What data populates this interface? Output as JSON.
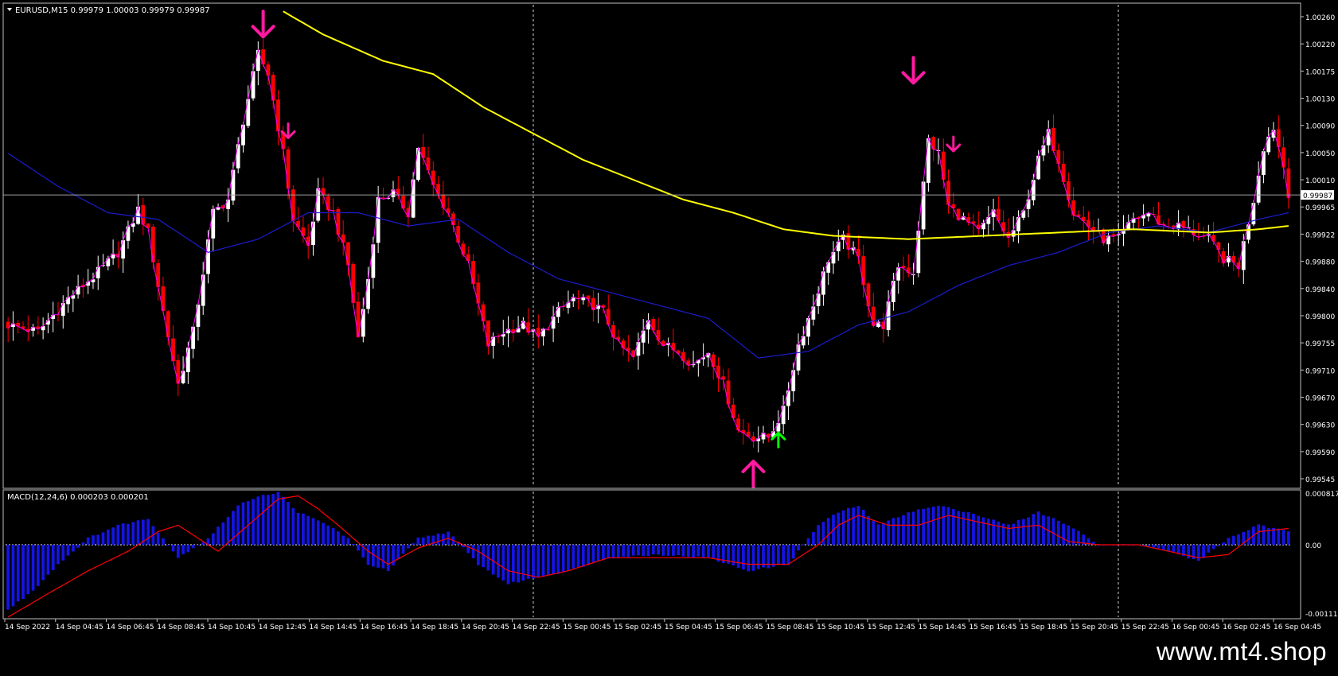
{
  "header": {
    "symbol_line": "EURUSD,M15  0.99979 1.00003 0.99979 0.99987",
    "macd_line": "MACD(12,24,6) 0.000203 0.000201"
  },
  "watermark": "www.mt4.shop",
  "colors": {
    "background": "#000000",
    "frame": "#c0c0c0",
    "bull_candle": "#ffffff",
    "bear_candle": "#ff0000",
    "sma_slow": "#ffff00",
    "sma_fast": "#1c1cd0",
    "close_line": "#ff00ff",
    "macd_hist": "#1414e6",
    "macd_signal": "#ff0000",
    "sell_arrow": "#ff1aa0",
    "buy_arrow": "#ff1aa0",
    "buy_arrow_small": "#00ff00",
    "current_price_line": "#a0a0a0"
  },
  "chart_data": [
    {
      "type": "candlestick",
      "symbol": "EURUSD",
      "timeframe": "M15",
      "current_price": "0.99987",
      "ylim": [
        0.99545,
        1.00275
      ],
      "y_ticks": [
        "1.00260",
        "1.00220",
        "1.00175",
        "1.00130",
        "1.00090",
        "1.00050",
        "1.00010",
        "0.99965",
        "0.99922",
        "0.99880",
        "0.99840",
        "0.99800",
        "0.99755",
        "0.99710",
        "0.99670",
        "0.99630",
        "0.99590",
        "0.99545"
      ],
      "x_ticks": [
        "14 Sep 2022",
        "14 Sep 04:45",
        "14 Sep 06:45",
        "14 Sep 08:45",
        "14 Sep 10:45",
        "14 Sep 12:45",
        "14 Sep 14:45",
        "14 Sep 16:45",
        "14 Sep 18:45",
        "14 Sep 20:45",
        "14 Sep 22:45",
        "15 Sep 00:45",
        "15 Sep 02:45",
        "15 Sep 04:45",
        "15 Sep 06:45",
        "15 Sep 08:45",
        "15 Sep 10:45",
        "15 Sep 12:45",
        "15 Sep 14:45",
        "15 Sep 16:45",
        "15 Sep 18:45",
        "15 Sep 20:45",
        "15 Sep 22:45",
        "16 Sep 00:45",
        "16 Sep 02:45",
        "16 Sep 04:45"
      ],
      "close_anchors": [
        [
          0,
          0.9979
        ],
        [
          6,
          0.9978
        ],
        [
          12,
          0.9983
        ],
        [
          18,
          0.9987
        ],
        [
          22,
          0.999
        ],
        [
          26,
          0.99965
        ],
        [
          28,
          0.9993
        ],
        [
          31,
          0.9981
        ],
        [
          34,
          0.997
        ],
        [
          37,
          0.9978
        ],
        [
          41,
          0.9996
        ],
        [
          44,
          0.9998
        ],
        [
          47,
          1.001
        ],
        [
          50,
          1.002
        ],
        [
          52,
          1.0017
        ],
        [
          55,
          1.0005
        ],
        [
          57,
          0.9995
        ],
        [
          60,
          0.9991
        ],
        [
          62,
          0.9999
        ],
        [
          65,
          0.9996
        ],
        [
          68,
          0.9988
        ],
        [
          70,
          0.9977
        ],
        [
          72,
          0.9986
        ],
        [
          74,
          0.9998
        ],
        [
          77,
          0.9999
        ],
        [
          80,
          0.9996
        ],
        [
          82,
          1.0006
        ],
        [
          85,
          1.0
        ],
        [
          88,
          0.9996
        ],
        [
          92,
          0.9988
        ],
        [
          96,
          0.9976
        ],
        [
          99,
          0.9978
        ],
        [
          103,
          0.9979
        ],
        [
          106,
          0.9977
        ],
        [
          110,
          0.9981
        ],
        [
          113,
          0.9983
        ],
        [
          117,
          0.9982
        ],
        [
          119,
          0.9981
        ],
        [
          122,
          0.9976
        ],
        [
          125,
          0.9974
        ],
        [
          128,
          0.998
        ],
        [
          131,
          0.9976
        ],
        [
          134,
          0.9975
        ],
        [
          137,
          0.9973
        ],
        [
          140,
          0.9975
        ],
        [
          143,
          0.997
        ],
        [
          146,
          0.9963
        ],
        [
          149,
          0.9962
        ],
        [
          152,
          0.9962
        ],
        [
          155,
          0.9966
        ],
        [
          158,
          0.9976
        ],
        [
          161,
          0.9982
        ],
        [
          164,
          0.9989
        ],
        [
          167,
          0.9992
        ],
        [
          170,
          0.9989
        ],
        [
          173,
          0.9979
        ],
        [
          175,
          0.9979
        ],
        [
          178,
          0.9988
        ],
        [
          181,
          0.9987
        ],
        [
          184,
          1.0007
        ],
        [
          186,
          1.0005
        ],
        [
          188,
          0.9997
        ],
        [
          191,
          0.9995
        ],
        [
          194,
          0.9993
        ],
        [
          197,
          0.9996
        ],
        [
          200,
          0.9992
        ],
        [
          203,
          0.9996
        ],
        [
          206,
          1.0004
        ],
        [
          208,
          1.0008
        ],
        [
          210,
          1.0004
        ],
        [
          213,
          0.9996
        ],
        [
          216,
          0.9994
        ],
        [
          219,
          0.9992
        ],
        [
          222,
          0.9992
        ],
        [
          225,
          0.9995
        ],
        [
          228,
          0.9996
        ],
        [
          231,
          0.9994
        ],
        [
          234,
          0.9994
        ],
        [
          237,
          0.9993
        ],
        [
          240,
          0.9992
        ],
        [
          243,
          0.9989
        ],
        [
          246,
          0.9988
        ],
        [
          249,
          0.9998
        ],
        [
          251,
          1.0006
        ],
        [
          253,
          1.0009
        ],
        [
          255,
          1.0003
        ],
        [
          256,
          0.9999
        ]
      ],
      "sma_slow_anchors": [
        [
          55,
          1.00265
        ],
        [
          63,
          1.0023
        ],
        [
          75,
          1.0019
        ],
        [
          85,
          1.0017
        ],
        [
          95,
          1.0012
        ],
        [
          105,
          1.0008
        ],
        [
          115,
          1.0004
        ],
        [
          125,
          1.0001
        ],
        [
          135,
          0.9998
        ],
        [
          145,
          0.9996
        ],
        [
          155,
          0.99935
        ],
        [
          165,
          0.99925
        ],
        [
          180,
          0.9992
        ],
        [
          195,
          0.99925
        ],
        [
          210,
          0.9993
        ],
        [
          225,
          0.99935
        ],
        [
          240,
          0.9993
        ],
        [
          250,
          0.99935
        ],
        [
          256,
          0.9994
        ]
      ],
      "sma_fast_anchors": [
        [
          0,
          1.0005
        ],
        [
          10,
          1.0
        ],
        [
          20,
          0.9996
        ],
        [
          30,
          0.9995
        ],
        [
          40,
          0.999
        ],
        [
          50,
          0.9992
        ],
        [
          60,
          0.9996
        ],
        [
          70,
          0.9996
        ],
        [
          80,
          0.9994
        ],
        [
          90,
          0.9995
        ],
        [
          100,
          0.999
        ],
        [
          110,
          0.9986
        ],
        [
          120,
          0.9984
        ],
        [
          130,
          0.9982
        ],
        [
          140,
          0.998
        ],
        [
          150,
          0.9974
        ],
        [
          160,
          0.9975
        ],
        [
          170,
          0.9979
        ],
        [
          180,
          0.9981
        ],
        [
          190,
          0.9985
        ],
        [
          200,
          0.9988
        ],
        [
          210,
          0.999
        ],
        [
          220,
          0.9993
        ],
        [
          230,
          0.9994
        ],
        [
          240,
          0.9993
        ],
        [
          250,
          0.9995
        ],
        [
          256,
          0.9996
        ]
      ],
      "signals": [
        {
          "bar": 51,
          "price": 1.00265,
          "dir": "down",
          "size": "large"
        },
        {
          "bar": 56,
          "price": 1.00095,
          "dir": "down",
          "size": "small"
        },
        {
          "bar": 149,
          "price": 0.99545,
          "dir": "up",
          "size": "large"
        },
        {
          "bar": 154,
          "price": 0.99605,
          "dir": "up",
          "size": "small_green"
        },
        {
          "bar": 181,
          "price": 1.00195,
          "dir": "down",
          "size": "large"
        },
        {
          "bar": 189,
          "price": 1.00075,
          "dir": "down",
          "size": "small"
        }
      ]
    },
    {
      "type": "histogram",
      "indicator": "MACD(12,24,6)",
      "ylim": [
        -0.001111,
        0.000817
      ],
      "y_ticks": [
        "0.000817",
        "0.00",
        "-0.001111"
      ],
      "signal_anchors": [
        [
          0,
          -0.00111
        ],
        [
          8,
          -0.00075
        ],
        [
          16,
          -0.0004
        ],
        [
          24,
          -0.0001
        ],
        [
          30,
          0.0002
        ],
        [
          34,
          0.0003
        ],
        [
          38,
          0.0001
        ],
        [
          42,
          -0.0001
        ],
        [
          48,
          0.0003
        ],
        [
          54,
          0.0007
        ],
        [
          58,
          0.00075
        ],
        [
          62,
          0.00055
        ],
        [
          66,
          0.0003
        ],
        [
          72,
          -0.0001
        ],
        [
          76,
          -0.0003
        ],
        [
          82,
          -5e-05
        ],
        [
          88,
          0.0001
        ],
        [
          94,
          -0.0001
        ],
        [
          100,
          -0.0004
        ],
        [
          106,
          -0.0005
        ],
        [
          112,
          -0.0004
        ],
        [
          120,
          -0.0002
        ],
        [
          130,
          -0.0002
        ],
        [
          140,
          -0.0002
        ],
        [
          148,
          -0.0003
        ],
        [
          156,
          -0.0003
        ],
        [
          162,
          0.0
        ],
        [
          166,
          0.0003
        ],
        [
          170,
          0.00045
        ],
        [
          176,
          0.0003
        ],
        [
          182,
          0.0003
        ],
        [
          188,
          0.00045
        ],
        [
          194,
          0.00035
        ],
        [
          200,
          0.00025
        ],
        [
          206,
          0.0003
        ],
        [
          212,
          5e-05
        ],
        [
          218,
          0.0
        ],
        [
          226,
          0.0
        ],
        [
          232,
          -0.0001
        ],
        [
          238,
          -0.0002
        ],
        [
          244,
          -0.00015
        ],
        [
          250,
          0.0002
        ],
        [
          256,
          0.00025
        ]
      ],
      "hist_anchors": [
        [
          0,
          -0.001
        ],
        [
          5,
          -0.0007
        ],
        [
          10,
          -0.0003
        ],
        [
          16,
          0.0001
        ],
        [
          22,
          0.0003
        ],
        [
          28,
          0.0004
        ],
        [
          34,
          -0.0002
        ],
        [
          40,
          0.0001
        ],
        [
          46,
          0.0006
        ],
        [
          50,
          0.00075
        ],
        [
          54,
          0.0008
        ],
        [
          58,
          0.0005
        ],
        [
          64,
          0.0003
        ],
        [
          68,
          0.0001
        ],
        [
          72,
          -0.0003
        ],
        [
          76,
          -0.0004
        ],
        [
          82,
          0.0001
        ],
        [
          88,
          0.0002
        ],
        [
          94,
          -0.0003
        ],
        [
          100,
          -0.0006
        ],
        [
          106,
          -0.0005
        ],
        [
          112,
          -0.0004
        ],
        [
          120,
          -0.0002
        ],
        [
          130,
          -0.00015
        ],
        [
          140,
          -0.0002
        ],
        [
          148,
          -0.0004
        ],
        [
          156,
          -0.0003
        ],
        [
          162,
          0.0003
        ],
        [
          166,
          0.0005
        ],
        [
          170,
          0.0006
        ],
        [
          174,
          0.0003
        ],
        [
          180,
          0.0005
        ],
        [
          186,
          0.0006
        ],
        [
          192,
          0.0005
        ],
        [
          200,
          0.0003
        ],
        [
          206,
          0.0005
        ],
        [
          212,
          0.0003
        ],
        [
          218,
          0.0
        ],
        [
          226,
          0.0
        ],
        [
          232,
          -0.0001
        ],
        [
          238,
          -0.00025
        ],
        [
          244,
          0.0001
        ],
        [
          250,
          0.0003
        ],
        [
          256,
          0.0002
        ]
      ]
    }
  ]
}
